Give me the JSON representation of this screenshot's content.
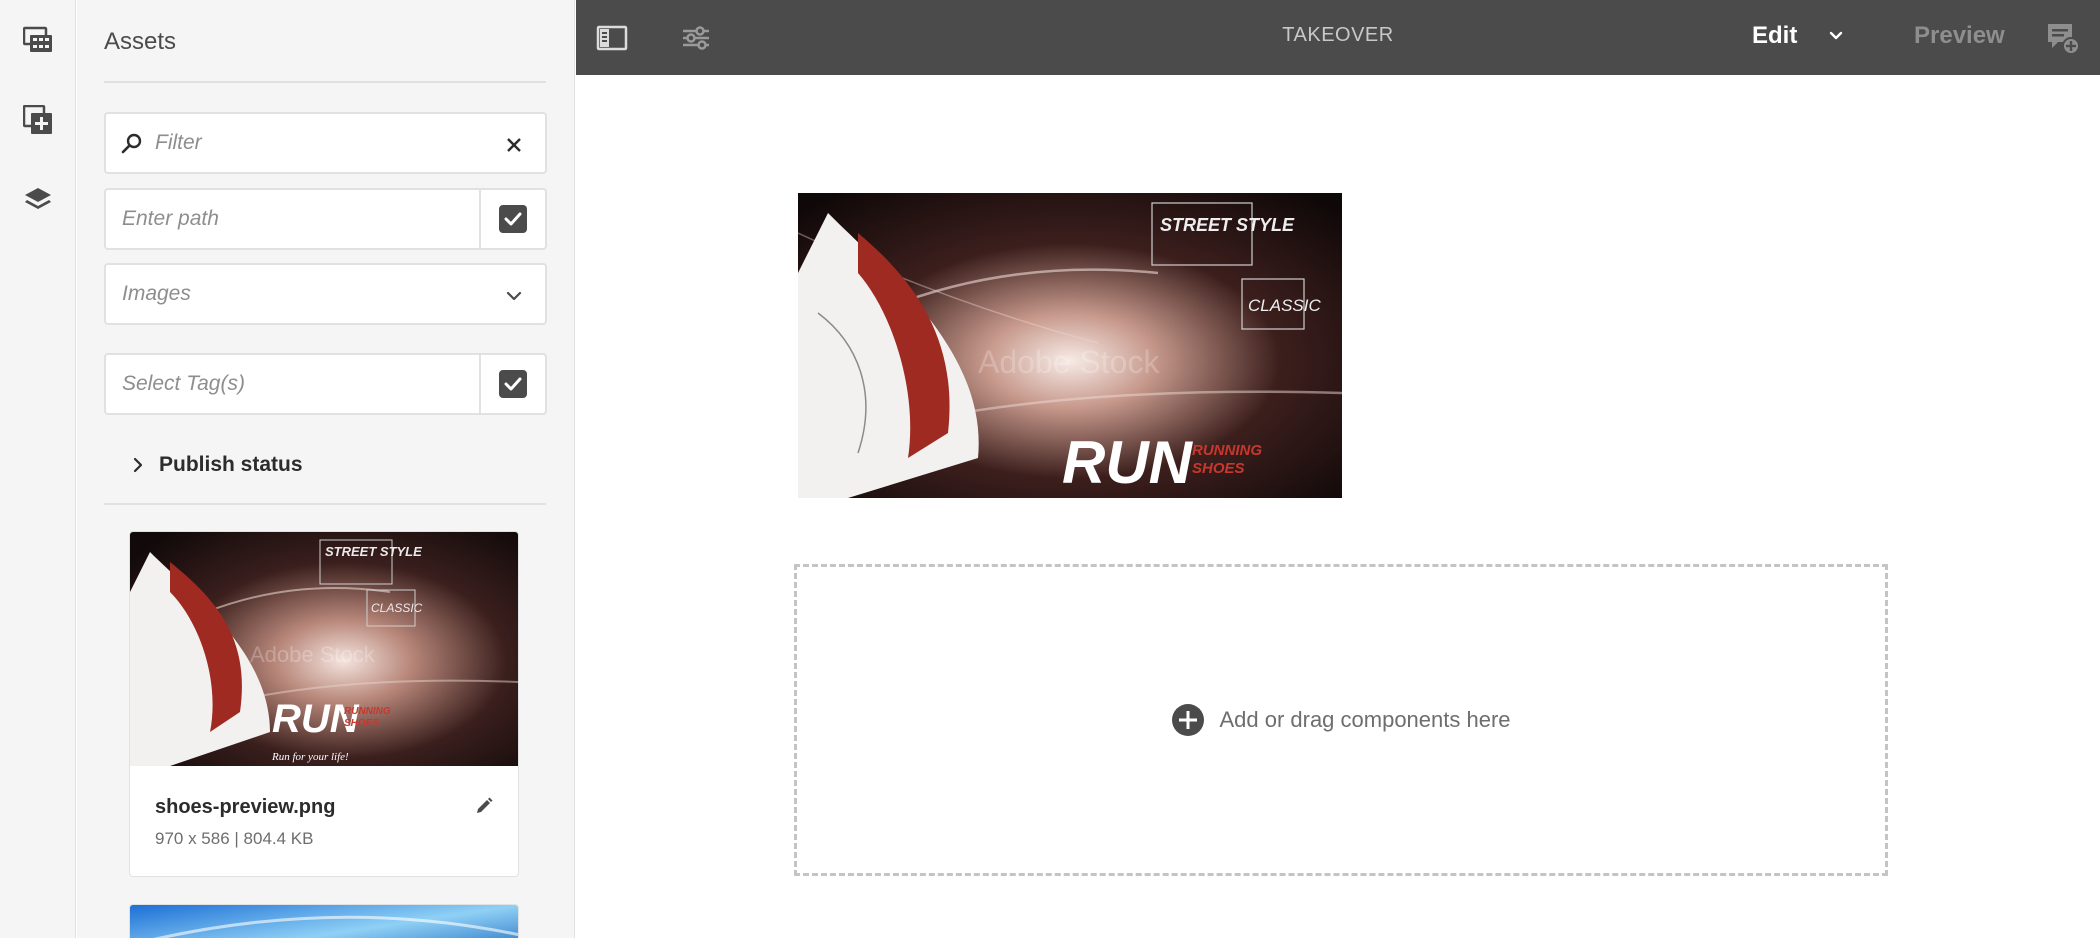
{
  "toolbar": {
    "title": "TAKEOVER",
    "mode_label": "Edit",
    "preview_label": "Preview",
    "icons": [
      "side-panel-icon",
      "page-properties-icon",
      "chevron-down-icon",
      "annotate-icon"
    ]
  },
  "rail": {
    "items": [
      {
        "name": "assets",
        "icon": "assets-icon"
      },
      {
        "name": "components",
        "icon": "components-icon"
      },
      {
        "name": "content-tree",
        "icon": "layers-icon"
      }
    ]
  },
  "panel": {
    "title": "Assets",
    "filter_placeholder": "Filter",
    "path_placeholder": "Enter path",
    "asset_type_selected": "Images",
    "tags_placeholder": "Select Tag(s)",
    "publish_status_label": "Publish status",
    "assets": [
      {
        "name": "shoes-preview.png",
        "meta": "970 x 586 | 804.4 KB",
        "thumb_text": {
          "street": "STREET STYLE",
          "classic": "CLASSIC",
          "run": "RUN",
          "running": "RUNNING",
          "shoes": "SHOES",
          "tagline": "Run for your life!",
          "watermark": "Adobe Stock"
        }
      }
    ]
  },
  "canvas": {
    "hero_text": {
      "street": "STREET STYLE",
      "classic": "CLASSIC",
      "run": "RUN",
      "running": "RUNNING",
      "shoes": "SHOES",
      "watermark": "Adobe Stock"
    },
    "dropzone_label": "Add or drag components here"
  },
  "colors": {
    "toolbar_bg": "#4b4b4b",
    "panel_bg": "#f5f5f5",
    "accent_red": "#b3261e"
  }
}
